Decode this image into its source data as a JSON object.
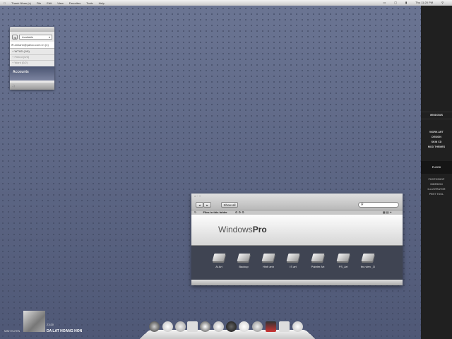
{
  "menubar": {
    "apple": "",
    "app": "Thanh Nhan (c)",
    "items": [
      "File",
      "Edit",
      "View",
      "Favorites",
      "Tools",
      "Help"
    ],
    "clock": "Thu 11:20 PM"
  },
  "sidebar": {
    "group1": [
      "WINDOWS"
    ],
    "group2": [
      "WORK ART",
      "DESIGN",
      "SKIN CD",
      "MOD THEMES"
    ],
    "group3": [
      "FLOCK"
    ],
    "group4": [
      "PHOTOSHOP",
      "INDESIGN",
      "ILLUSTRATOR",
      "PENT TOOL"
    ]
  },
  "messenger": {
    "status": "Available",
    "email": "anhanh@yahoo.com.vn (4)",
    "groups": [
      "WTUD (1/6)",
      "Friend (0/3)",
      "Work (0/2)"
    ],
    "footer": "Accounts"
  },
  "finder": {
    "show_all": "Show all",
    "search_placeholder": "",
    "path_label": "Files in this folder",
    "banner_a": "Windows",
    "banner_b": "Pro",
    "folders": [
      "Ai Art",
      "Backup",
      "Hinh anh",
      "IS art",
      "Painter Art",
      "PS_Art",
      "thu vien _D"
    ]
  },
  "music": {
    "artist": "MINH HUYEN",
    "time": "23:20",
    "song": "DA LAT HOANG HON"
  },
  "colors": {
    "desktop": "#5a6482",
    "sidebar": "#202020",
    "folder_area": "#3f4452"
  }
}
